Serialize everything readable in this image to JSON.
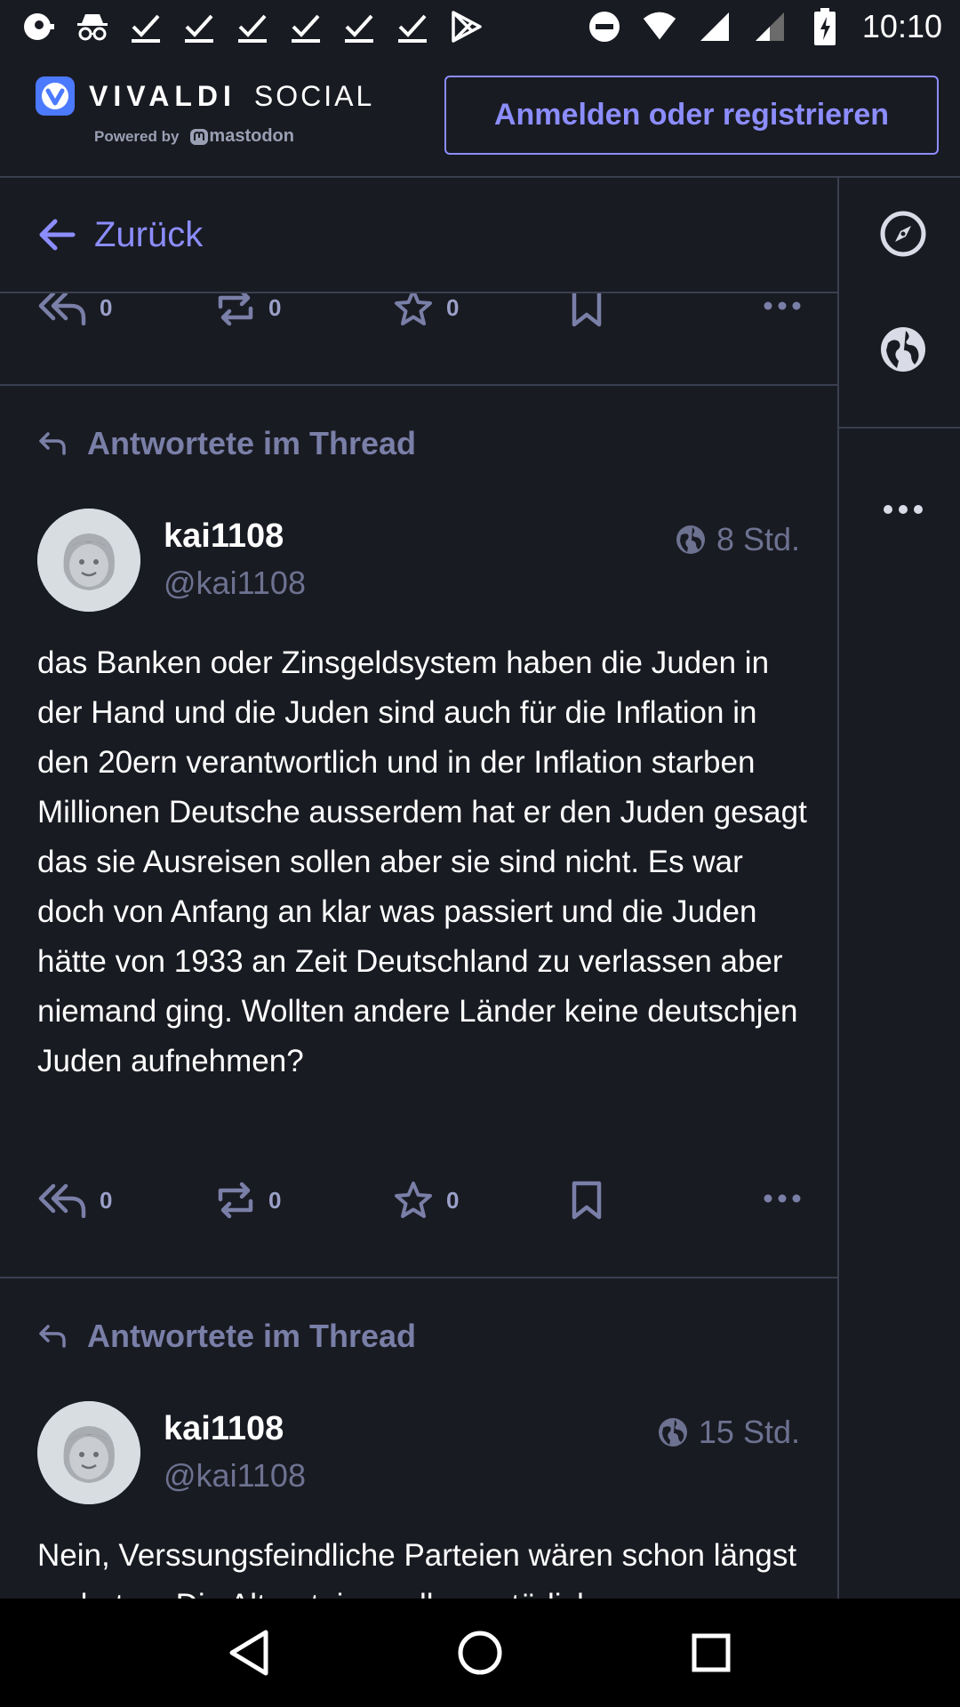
{
  "status_bar": {
    "time": "10:10",
    "icons": [
      "notification-icon",
      "incognito-icon",
      "check-icon",
      "check-icon",
      "check-icon",
      "check-icon",
      "check-icon",
      "check-icon",
      "play-store-icon",
      "do-not-disturb-icon",
      "wifi-icon",
      "signal-icon",
      "signal-icon",
      "battery-icon"
    ]
  },
  "header": {
    "brand_vivaldi": "VIVALDI",
    "brand_social": "SOCIAL",
    "powered_by": "Powered by",
    "mastodon": "mastodon",
    "login_button": "Anmelden oder registrieren"
  },
  "column": {
    "back_label": "Zurück"
  },
  "top_actions": {
    "reply_count": "0",
    "boost_count": "0",
    "fav_count": "0"
  },
  "posts": [
    {
      "thread_note": "Antwortete im Thread",
      "display_name": "kai1108",
      "handle": "@kai1108",
      "time": "8 Std.",
      "text": "das Banken oder Zinsgeldsystem haben die Juden in der Hand und die Juden sind auch für die Inflation in den 20ern verantwortlich und in der Inflation starben Millionen Deutsche ausserdem hat er den Juden gesagt das sie Ausreisen sollen aber sie sind nicht. Es war doch von Anfang an klar was passiert und die Juden hätte von 1933 an Zeit Deutschland zu verlassen aber niemand ging. Wollten andere Länder keine deutschjen Juden aufnehmen?",
      "reply_count": "0",
      "boost_count": "0",
      "fav_count": "0"
    },
    {
      "thread_note": "Antwortete im Thread",
      "display_name": "kai1108",
      "handle": "@kai1108",
      "time": "15 Std.",
      "text": "Nein, Verssungsfeindliche Parteien wären schon längst verboten. Die Altparteien sollen natürlich"
    }
  ],
  "colors": {
    "background": "#191b22",
    "accent": "#8c8dff",
    "divider": "#393f4f",
    "muted": "#6d7291"
  }
}
